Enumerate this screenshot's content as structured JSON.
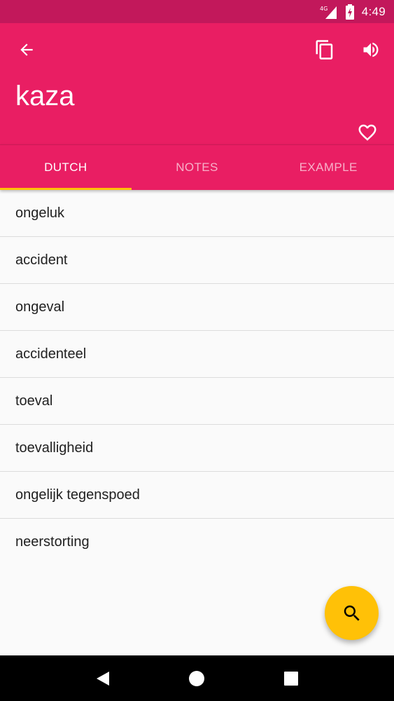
{
  "status_bar": {
    "network": "4G",
    "time": "4:49"
  },
  "app_bar": {
    "title": "kaza",
    "icons": {
      "back": "back-arrow-icon",
      "copy": "copy-icon",
      "volume": "volume-icon",
      "favorite": "heart-outline-icon"
    }
  },
  "tabs": [
    {
      "label": "DUTCH",
      "active": true
    },
    {
      "label": "NOTES",
      "active": false
    },
    {
      "label": "EXAMPLE",
      "active": false
    }
  ],
  "translations": [
    "ongeluk",
    "accident",
    "ongeval",
    "accidenteel",
    "toeval",
    "toevalligheid",
    "ongelijk tegenspoed",
    "neerstorting"
  ],
  "fab": {
    "icon": "search-icon"
  },
  "colors": {
    "primary": "#e91e63",
    "primary_dark": "#c2185b",
    "accent": "#ffc107"
  }
}
